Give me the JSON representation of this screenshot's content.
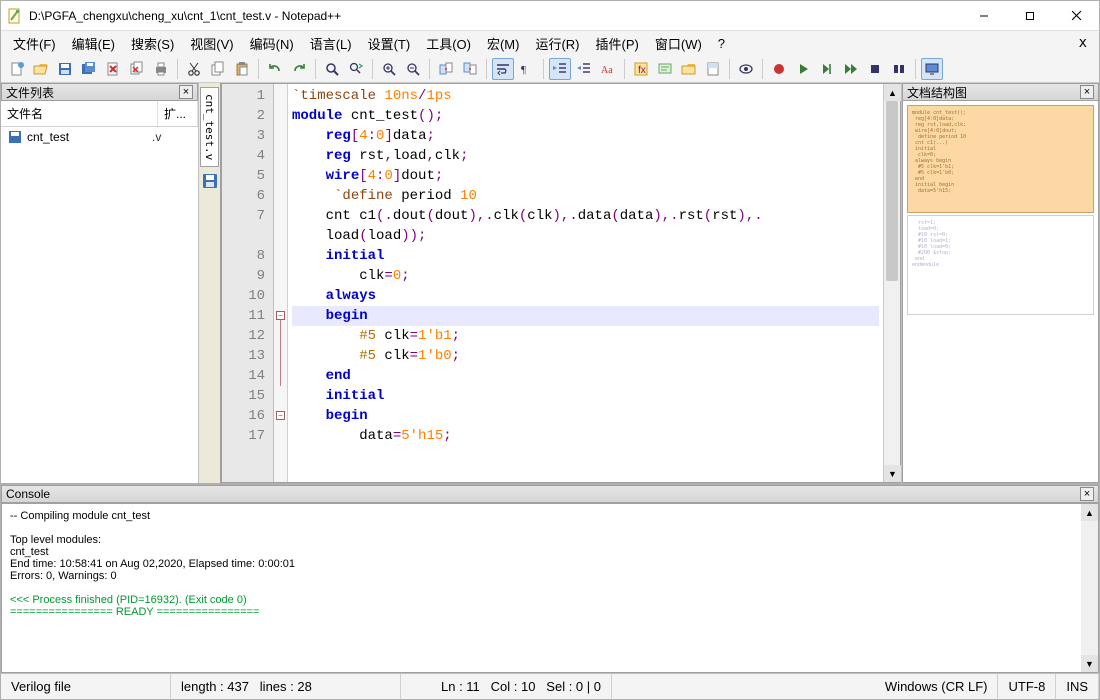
{
  "title": "D:\\PGFA_chengxu\\cheng_xu\\cnt_1\\cnt_test.v - Notepad++",
  "menu": [
    "文件(F)",
    "编辑(E)",
    "搜索(S)",
    "视图(V)",
    "编码(N)",
    "语言(L)",
    "设置(T)",
    "工具(O)",
    "宏(M)",
    "运行(R)",
    "插件(P)",
    "窗口(W)",
    "?"
  ],
  "left_panel": {
    "title": "文件列表",
    "cols": {
      "name": "文件名",
      "ext": "扩..."
    },
    "files": [
      {
        "name": "cnt_test",
        "ext": ".v"
      }
    ]
  },
  "vtab": "cnt_test.v",
  "right_panel": {
    "title": "文档结构图"
  },
  "code_lines": [
    {
      "n": 1,
      "html": "<span class='tok-dir'>`timescale</span> <span class='tok-num'>10ns</span><span class='tok-punc'>/</span><span class='tok-num'>1ps</span>"
    },
    {
      "n": 2,
      "html": "<span class='tok-kw'>module</span> cnt_test<span class='tok-punc'>();</span>"
    },
    {
      "n": 3,
      "html": "    <span class='tok-kw'>reg</span><span class='tok-punc'>[</span><span class='tok-num'>4</span><span class='tok-punc'>:</span><span class='tok-num'>0</span><span class='tok-punc'>]</span>data<span class='tok-punc'>;</span>"
    },
    {
      "n": 4,
      "html": "    <span class='tok-kw'>reg</span> rst<span class='tok-punc'>,</span>load<span class='tok-punc'>,</span>clk<span class='tok-punc'>;</span>"
    },
    {
      "n": 5,
      "html": "    <span class='tok-kw'>wire</span><span class='tok-punc'>[</span><span class='tok-num'>4</span><span class='tok-punc'>:</span><span class='tok-num'>0</span><span class='tok-punc'>]</span>dout<span class='tok-punc'>;</span>"
    },
    {
      "n": 6,
      "html": "     <span class='tok-dir'>`define</span> period <span class='tok-num'>10</span>"
    },
    {
      "n": 7,
      "html": "    cnt c1<span class='tok-punc'>(.</span>dout<span class='tok-punc'>(</span>dout<span class='tok-punc'>),.</span>clk<span class='tok-punc'>(</span>clk<span class='tok-punc'>),.</span>data<span class='tok-punc'>(</span>data<span class='tok-punc'>),.</span>rst<span class='tok-punc'>(</span>rst<span class='tok-punc'>),.</span><br>    load<span class='tok-punc'>(</span>load<span class='tok-punc'>));</span>",
      "rows": 2
    },
    {
      "n": 8,
      "html": "    <span class='tok-kw'>initial</span>"
    },
    {
      "n": 9,
      "html": "        clk<span class='tok-punc'>=</span><span class='tok-num'>0</span><span class='tok-punc'>;</span>"
    },
    {
      "n": 10,
      "html": "    <span class='tok-kw'>always</span>"
    },
    {
      "n": 11,
      "html": "    <span class='tok-kw'>begin</span>",
      "current": true
    },
    {
      "n": 12,
      "html": "        <span class='tok-delay'>#5</span> clk<span class='tok-punc'>=</span><span class='tok-num'>1'b1</span><span class='tok-punc'>;</span>"
    },
    {
      "n": 13,
      "html": "        <span class='tok-delay'>#5</span> clk<span class='tok-punc'>=</span><span class='tok-num'>1'b0</span><span class='tok-punc'>;</span>"
    },
    {
      "n": 14,
      "html": "    <span class='tok-kw'>end</span>"
    },
    {
      "n": 15,
      "html": "    <span class='tok-kw'>initial</span>"
    },
    {
      "n": 16,
      "html": "    <span class='tok-kw'>begin</span>"
    },
    {
      "n": 17,
      "html": "        data<span class='tok-punc'>=</span><span class='tok-num'>5'h15</span><span class='tok-punc'>;</span>"
    }
  ],
  "console": {
    "title": "Console",
    "lines": [
      {
        "t": "-- Compiling module cnt_test"
      },
      {
        "t": ""
      },
      {
        "t": "Top level modules:"
      },
      {
        "t": "          cnt_test"
      },
      {
        "t": "End time: 10:58:41 on Aug 02,2020, Elapsed time: 0:00:01"
      },
      {
        "t": "Errors: 0, Warnings: 0"
      },
      {
        "t": ""
      },
      {
        "t": "<<< Process finished (PID=16932). (Exit code 0)",
        "cls": "green"
      },
      {
        "t": "================ READY ================",
        "cls": "green"
      }
    ]
  },
  "status": {
    "lang": "Verilog file",
    "length": "length : 437",
    "lines": "lines : 28",
    "ln": "Ln : 11",
    "col": "Col : 10",
    "sel": "Sel : 0 | 0",
    "eol": "Windows (CR LF)",
    "enc": "UTF-8",
    "ins": "INS"
  }
}
